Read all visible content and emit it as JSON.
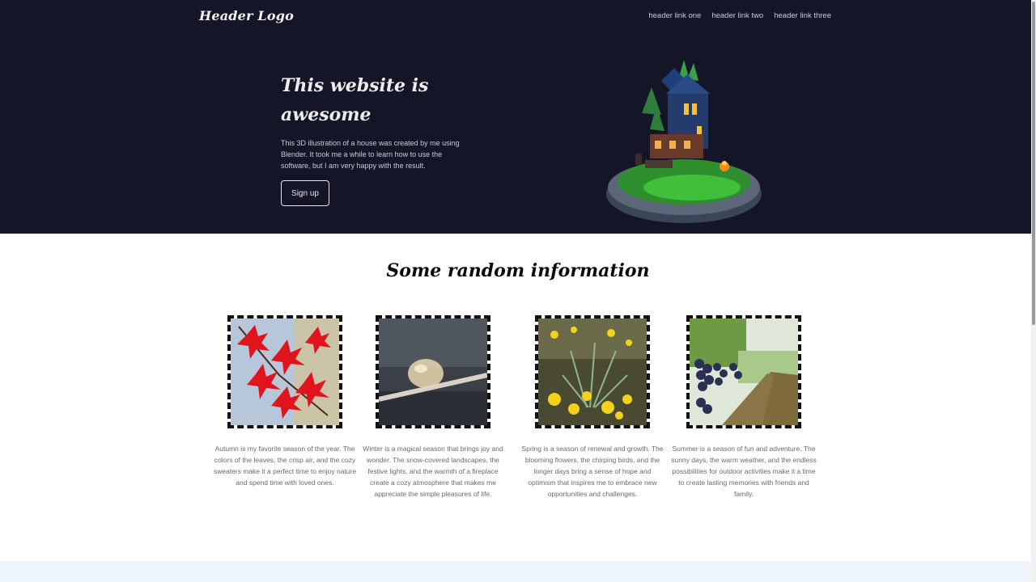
{
  "header": {
    "logo": "Header Logo",
    "links": [
      "header link one",
      "header link two",
      "header link three"
    ]
  },
  "hero": {
    "title": "This website is awesome",
    "text": "This 3D illustration of a house was created by me using Blender. It took me a while to learn how to use the software, but I am very happy with the result.",
    "signup_label": "Sign up"
  },
  "section": {
    "title": "Some random information",
    "cards": [
      {
        "caption": "Autumn is my favorite season of the year. The colors of the leaves, the crisp air, and the cozy sweaters make it a perfect time to enjoy nature and spend time with loved ones."
      },
      {
        "caption": "Winter is a magical season that brings joy and wonder. The snow-covered landscapes, the festive lights, and the warmth of a fireplace create a cozy atmosphere that makes me appreciate the simple pleasures of life."
      },
      {
        "caption": "Spring is a season of renewal and growth. The blooming flowers, the chirping birds, and the longer days bring a sense of hope and optimism that inspires me to embrace new opportunities and challenges."
      },
      {
        "caption": "Summer is a season of fun and adventure. The sunny days, the warm weather, and the endless possibilities for outdoor activities make it a time to create lasting memories with friends and family."
      }
    ]
  },
  "colors": {
    "hero_bg": "#141628",
    "footer_strip": "#eef5fd"
  }
}
